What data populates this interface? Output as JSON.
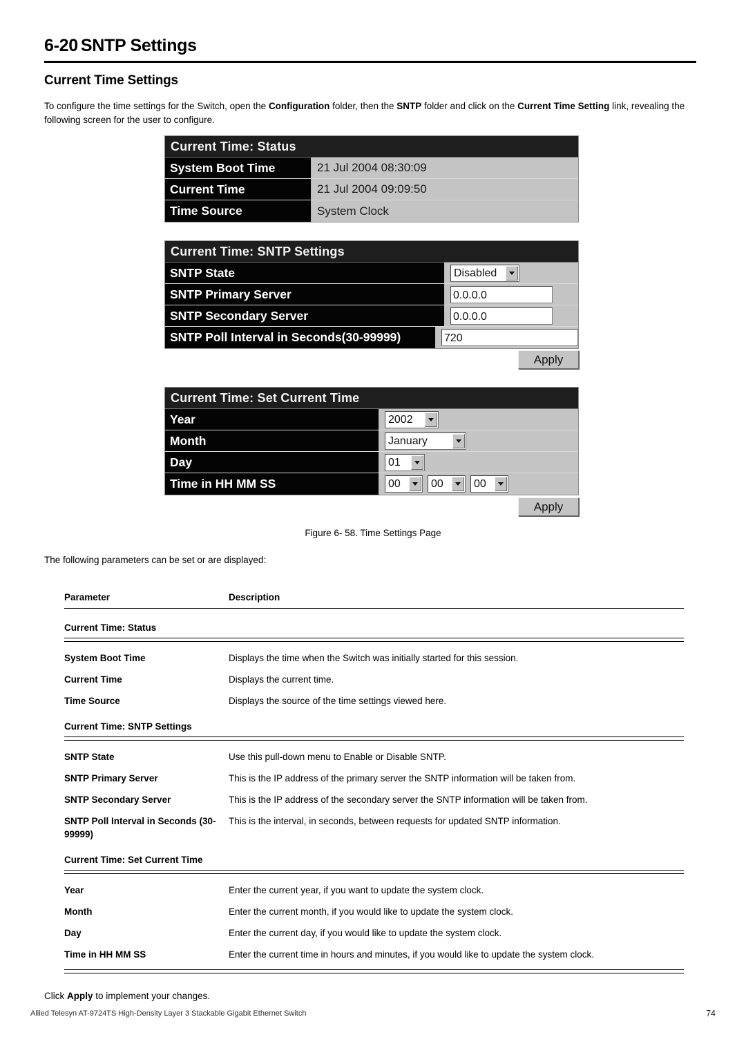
{
  "document": {
    "section_number": "6-20",
    "section_title": "SNTP Settings",
    "subsection_title": "Current Time Settings",
    "intro_part1": "To configure the time settings for the Switch, open the ",
    "intro_bold1": "Configuration",
    "intro_part2": " folder, then the ",
    "intro_bold2": "SNTP",
    "intro_part3": " folder and click on the ",
    "intro_bold3": "Current Time Setting",
    "intro_part4": " link, revealing the following screen for the user to configure.",
    "figure_caption": "Figure 6- 58. Time Settings Page",
    "params_note": "The following parameters can be set or are displayed:",
    "closing_pre": "Click ",
    "closing_bold": "Apply",
    "closing_post": " to implement your changes.",
    "footer_left": "Allied Telesyn AT-9724TS High-Density Layer 3 Stackable Gigabit Ethernet Switch",
    "footer_page": "74"
  },
  "screenshot": {
    "status_panel": {
      "header": "Current Time: Status",
      "rows": [
        {
          "label": "System Boot Time",
          "value": "21 Jul 2004 08:30:09"
        },
        {
          "label": "Current Time",
          "value": "21 Jul 2004 09:09:50"
        },
        {
          "label": "Time Source",
          "value": "System Clock"
        }
      ]
    },
    "sntp_panel": {
      "header": "Current Time: SNTP Settings",
      "state_label": "SNTP State",
      "state_value": "Disabled",
      "primary_label": "SNTP Primary Server",
      "primary_value": "0.0.0.0",
      "secondary_label": "SNTP Secondary Server",
      "secondary_value": "0.0.0.0",
      "poll_label": "SNTP Poll Interval in Seconds(30-99999)",
      "poll_value": "720",
      "apply_label": "Apply"
    },
    "set_time_panel": {
      "header": "Current Time: Set Current Time",
      "year_label": "Year",
      "year_value": "2002",
      "month_label": "Month",
      "month_value": "January",
      "day_label": "Day",
      "day_value": "01",
      "time_label": "Time in HH MM SS",
      "hh_value": "00",
      "mm_value": "00",
      "ss_value": "00",
      "apply_label": "Apply"
    }
  },
  "param_table": {
    "header_parameter": "Parameter",
    "header_description": "Description",
    "groups": [
      {
        "title": "Current Time: Status",
        "rows": [
          {
            "name": "System Boot Time",
            "desc": "Displays the time when the Switch was initially started for this session."
          },
          {
            "name": "Current Time",
            "desc": "Displays the current time."
          },
          {
            "name": "Time Source",
            "desc": "Displays the source of the time settings viewed here."
          }
        ]
      },
      {
        "title": "Current Time: SNTP Settings",
        "rows": [
          {
            "name": "SNTP State",
            "desc": "Use this pull-down menu to Enable or Disable SNTP."
          },
          {
            "name": "SNTP Primary Server",
            "desc": "This is the IP address of the primary server the SNTP information will be taken from."
          },
          {
            "name": "SNTP Secondary Server",
            "desc": "This is the IP address of the secondary server the SNTP information will be taken from."
          },
          {
            "name": "SNTP Poll Interval in Seconds (30-99999)",
            "desc": "This is the interval, in seconds, between requests for updated SNTP information."
          }
        ]
      },
      {
        "title": "Current Time: Set Current Time",
        "rows": [
          {
            "name": "Year",
            "desc": "Enter the current year, if you want to update the system clock."
          },
          {
            "name": "Month",
            "desc": "Enter the current month, if you would like to update the system clock."
          },
          {
            "name": "Day",
            "desc": "Enter the current day, if you would like to update the system clock."
          },
          {
            "name": "Time in HH MM SS",
            "desc": "Enter the current time in hours and minutes, if you would like to update the system clock."
          }
        ]
      }
    ]
  },
  "colors": {
    "panel_header_bg": "#1e1e1e",
    "panel_label_bg": "#040404",
    "panel_value_bg": "#c4c4c4",
    "button_bg": "#c4c4c4",
    "page_bg": "#ffffff",
    "text": "#000000"
  }
}
